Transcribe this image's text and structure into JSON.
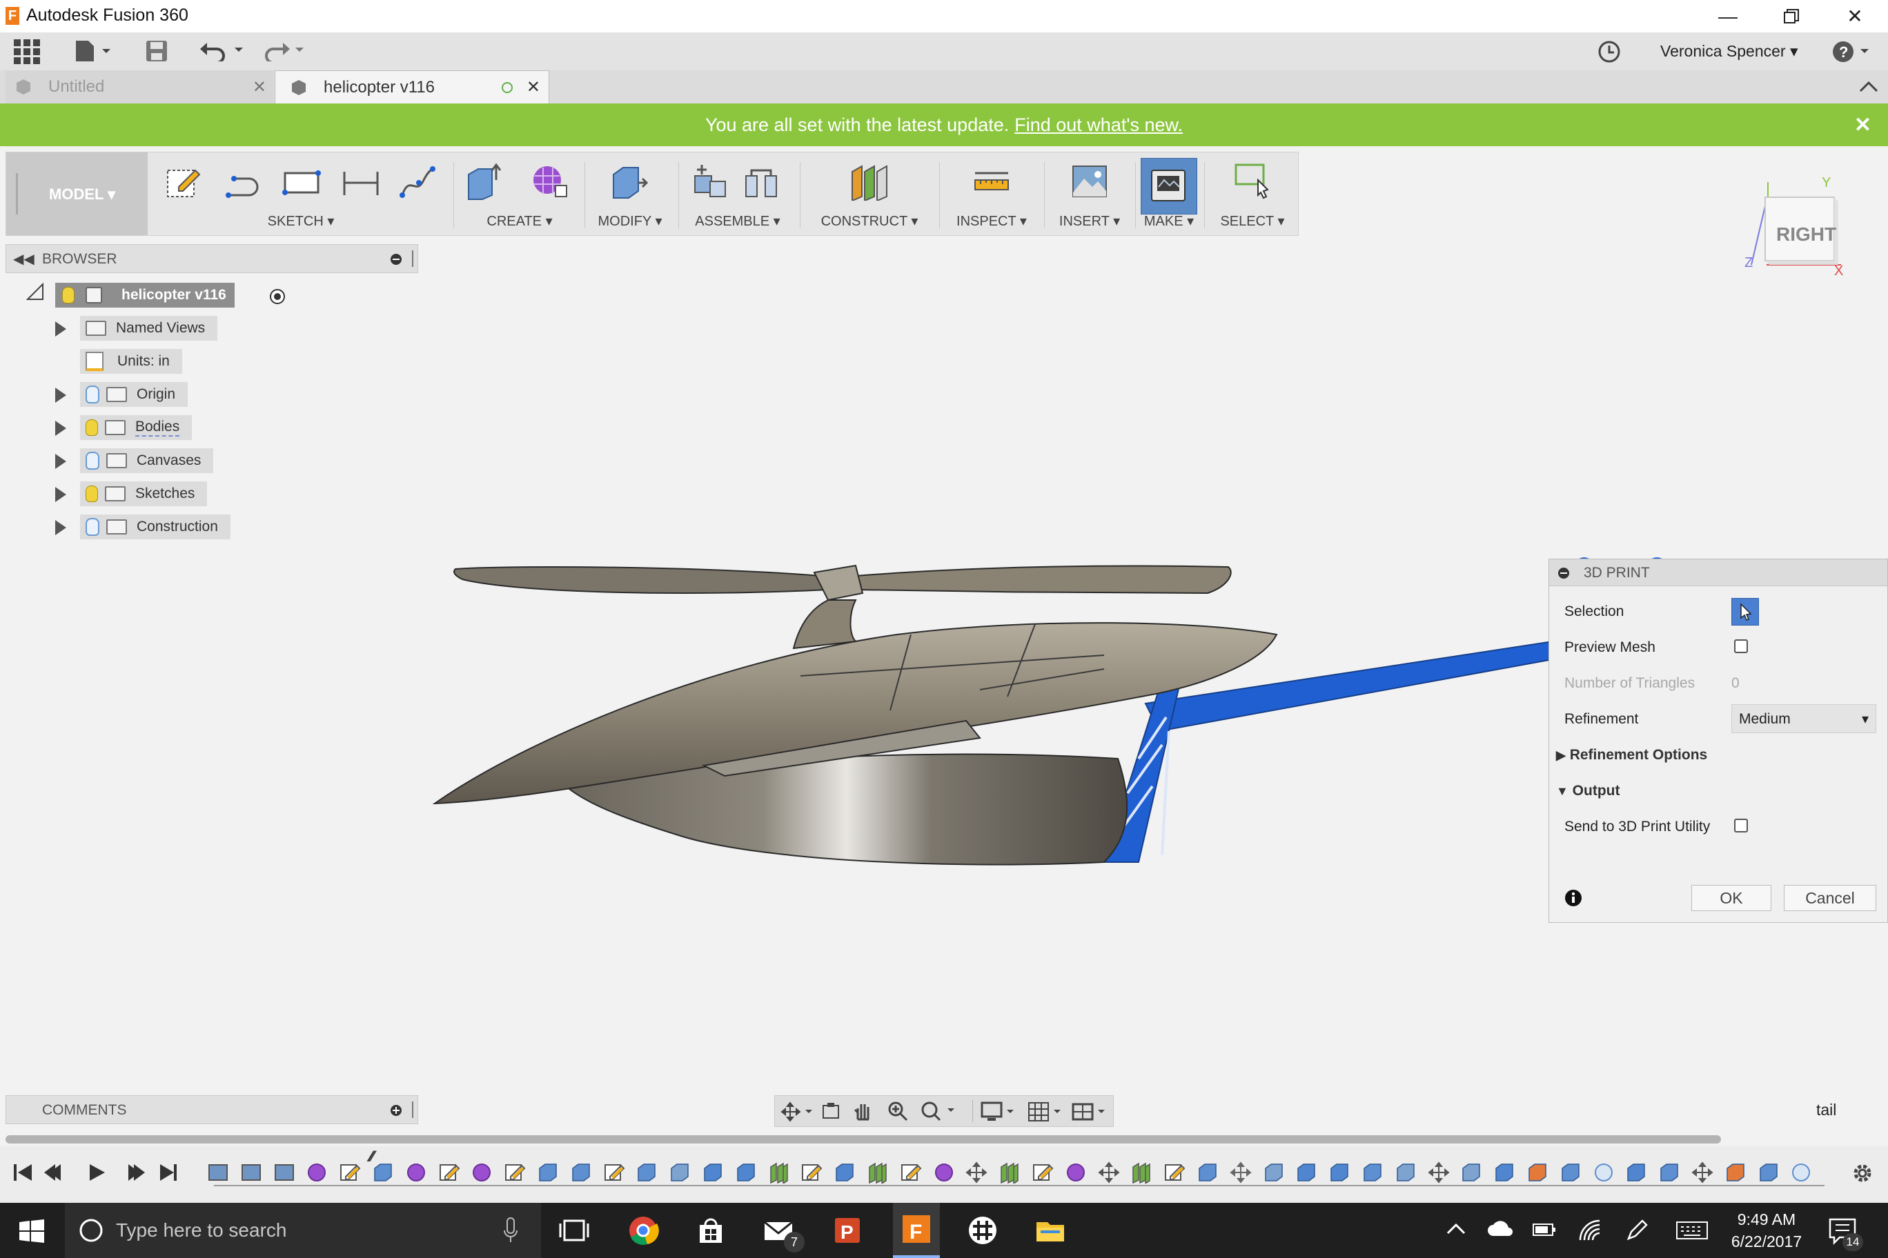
{
  "window": {
    "title": "Autodesk Fusion 360",
    "app_logo_letter": "F"
  },
  "appbar": {
    "user_name": "Veronica Spencer"
  },
  "tabs": [
    {
      "label": "Untitled",
      "active": false
    },
    {
      "label": "helicopter v116",
      "active": true
    }
  ],
  "banner": {
    "message": "You are all set with the latest update.",
    "link": "Find out what's new."
  },
  "toolbar": {
    "workspace": "MODEL ▾",
    "groups": [
      {
        "label": "SKETCH ▾"
      },
      {
        "label": "CREATE ▾"
      },
      {
        "label": "MODIFY ▾"
      },
      {
        "label": "ASSEMBLE ▾"
      },
      {
        "label": "CONSTRUCT ▾"
      },
      {
        "label": "INSPECT ▾"
      },
      {
        "label": "INSERT ▾"
      },
      {
        "label": "MAKE ▾"
      },
      {
        "label": "SELECT ▾"
      }
    ]
  },
  "browser": {
    "header": "BROWSER",
    "root": "helicopter v116",
    "items": [
      {
        "label": "Named Views"
      },
      {
        "label": "Units: in"
      },
      {
        "label": "Origin"
      },
      {
        "label": "Bodies"
      },
      {
        "label": "Canvases"
      },
      {
        "label": "Sketches"
      },
      {
        "label": "Construction"
      }
    ]
  },
  "viewcube": {
    "face": "RIGHT",
    "axis_y": "Y",
    "axis_z": "Z",
    "axis_x": "X"
  },
  "dialog": {
    "title": "3D PRINT",
    "selection_label": "Selection",
    "preview_mesh_label": "Preview Mesh",
    "triangles_label": "Number of Triangles",
    "triangles_value": "0",
    "refinement_label": "Refinement",
    "refinement_value": "Medium",
    "refinement_options_label": "Refinement Options",
    "output_label": "Output",
    "send_label": "Send to 3D Print Utility",
    "ok_label": "OK",
    "cancel_label": "Cancel"
  },
  "comments": {
    "header": "COMMENTS"
  },
  "status": {
    "label": "tail"
  },
  "taskbar": {
    "search_placeholder": "Type here to search",
    "time": "9:49 AM",
    "date": "6/22/2017",
    "mail_badge": "7",
    "notif_badge": "14"
  },
  "colors": {
    "banner": "#8cc63f",
    "accent_blue": "#1f5fd1",
    "model_body": "#8a8273"
  }
}
